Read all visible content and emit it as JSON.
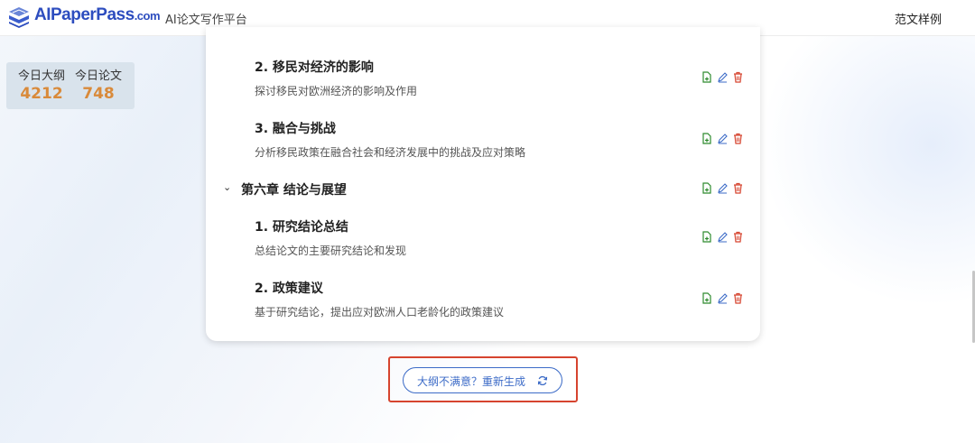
{
  "header": {
    "logo_main": "AIPaperPass",
    "logo_suffix": ".com",
    "subtitle": "AI论文写作平台",
    "nav_sample": "范文样例"
  },
  "stats": [
    {
      "label": "今日大纲",
      "value": "4212"
    },
    {
      "label": "今日论文",
      "value": "748"
    }
  ],
  "outline": {
    "sections": [
      {
        "title": "2. 移民对经济的影响",
        "desc": "探讨移民对欧洲经济的影响及作用"
      },
      {
        "title": "3. 融合与挑战",
        "desc": "分析移民政策在融合社会和经济发展中的挑战及应对策略"
      },
      {
        "title": "1. 研究结论总结",
        "desc": "总结论文的主要研究结论和发现"
      },
      {
        "title": "2. 政策建议",
        "desc": "基于研究结论，提出应对欧洲人口老龄化的政策建议"
      }
    ],
    "chapter": {
      "title": "第六章 结论与展望",
      "chevron": "⌄"
    }
  },
  "regenerate": {
    "label": "大纲不满意？重新生成"
  },
  "colors": {
    "brand": "#2d4dbf",
    "accent_orange": "#d98a3a",
    "highlight_red": "#d6442f",
    "button_blue": "#3c6bc7"
  },
  "icons": [
    "logo-icon",
    "add-doc-icon",
    "edit-icon",
    "delete-icon",
    "refresh-icon",
    "chevron-down-icon"
  ]
}
